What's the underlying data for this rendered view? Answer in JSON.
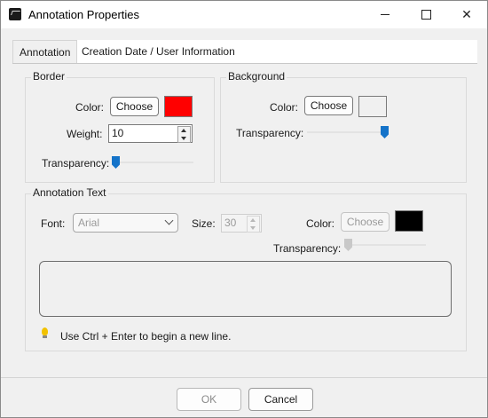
{
  "window": {
    "title": "Annotation Properties",
    "app_icon": "app-icon"
  },
  "tabs": [
    {
      "label": "Annotation"
    },
    {
      "label": "Creation Date / User Information"
    }
  ],
  "border": {
    "group_title": "Border",
    "color_label": "Color:",
    "choose_label": "Choose",
    "color": "#ff0000",
    "weight_label": "Weight:",
    "weight_value": "10",
    "transparency_label": "Transparency:",
    "transparency_level": 0.0
  },
  "background": {
    "group_title": "Background",
    "color_label": "Color:",
    "choose_label": "Choose",
    "color": "#f0f0f0",
    "transparency_label": "Transparency:",
    "transparency_level": 1.0
  },
  "annotation_text": {
    "group_title": "Annotation Text",
    "font_label": "Font:",
    "font_value": "Arial",
    "size_label": "Size:",
    "size_value": "30",
    "color_label": "Color:",
    "choose_label": "Choose",
    "color": "#000000",
    "transparency_label": "Transparency:",
    "transparency_level": 0.0,
    "text_value": "",
    "hint": "Use Ctrl + Enter to begin a new line."
  },
  "footer": {
    "ok_label": "OK",
    "cancel_label": "Cancel"
  }
}
